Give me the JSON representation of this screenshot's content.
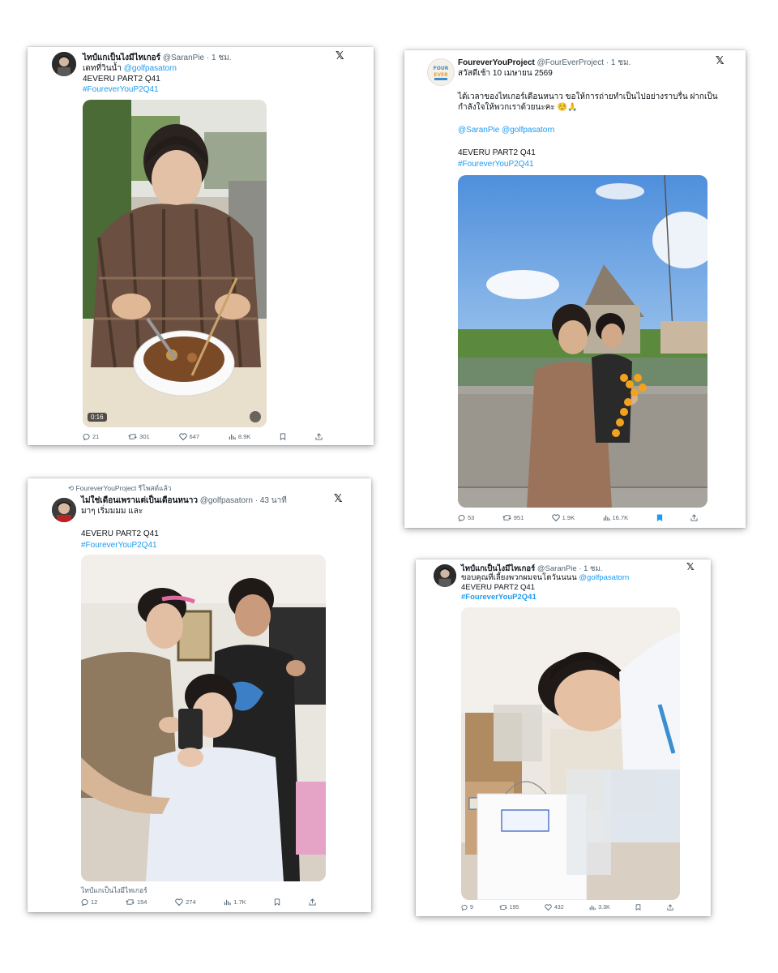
{
  "tweet1": {
    "name": "ไทป์แกเป็นไงมีไทเกอร์",
    "handle": "@SaranPie",
    "time": "· 1 ชม.",
    "line1_prefix": "เดทที่วินน้ำ ",
    "line1_mention": "@golfpasatorn",
    "line2": "4EVERU PART2 Q41",
    "hashtag": "#FoureverYouP2Q41",
    "video_duration": "0:16",
    "replies": "21",
    "reposts": "301",
    "likes": "647",
    "views": "8.9K"
  },
  "tweet2": {
    "name": "FoureverYouProject",
    "handle": "@FourEverProject",
    "time": "· 1 ชม.",
    "avatar_text": "FOUR EVER",
    "line1": "สวัสดีเช้า 10 เมษายน 2569",
    "line2": "ได้เวลาของไทเกอร์เดือนหนาว ขอให้การถ่ายทำเป็นไปอย่างราบรื่น ฝากเป็น",
    "line3": "กำลังใจให้พวกเราด้วยนะคะ ☺️🙏",
    "mentions": "@SaranPie @golfpasatorn",
    "line4": "4EVERU PART2 Q41",
    "hashtag": "#FoureverYouP2Q41",
    "replies": "53",
    "reposts": "951",
    "likes": "1.9K",
    "views": "16.7K"
  },
  "tweet3": {
    "repost_note": "FoureverYouProject รีโพสต์แล้ว",
    "name": "ไม่ใช่เดือนเพราแต่เป็นเดือนหนาว",
    "handle": "@golfpasatorn",
    "time": "· 43 นาที",
    "line1": "มาๆ เริ่มมมม และ",
    "line2": "4EVERU PART2 Q41",
    "hashtag": "#FoureverYouP2Q41",
    "quote_author": "ไทป์แกเป็นไงมีไทเกอร์",
    "replies": "12",
    "reposts": "154",
    "likes": "274",
    "views": "1.7K"
  },
  "tweet4": {
    "name": "ไทป์แกเป็นไงมีไทเกอร์",
    "handle": "@SaranPie",
    "time": "· 1 ชม.",
    "line1_prefix": "ขอบคุณที่เลี้ยงพวกผมจนโตวันนนน ",
    "line1_mention": "@golfpasatorn",
    "line2": "4EVERU PART2 Q41",
    "hashtag": "#FoureverYouP2Q41",
    "replies": "9",
    "reposts": "195",
    "likes": "432",
    "views": "3.3K"
  },
  "colors": {
    "link": "#1d9bf0",
    "muted": "#536471",
    "bookmark_active": "#1d9bf0"
  }
}
